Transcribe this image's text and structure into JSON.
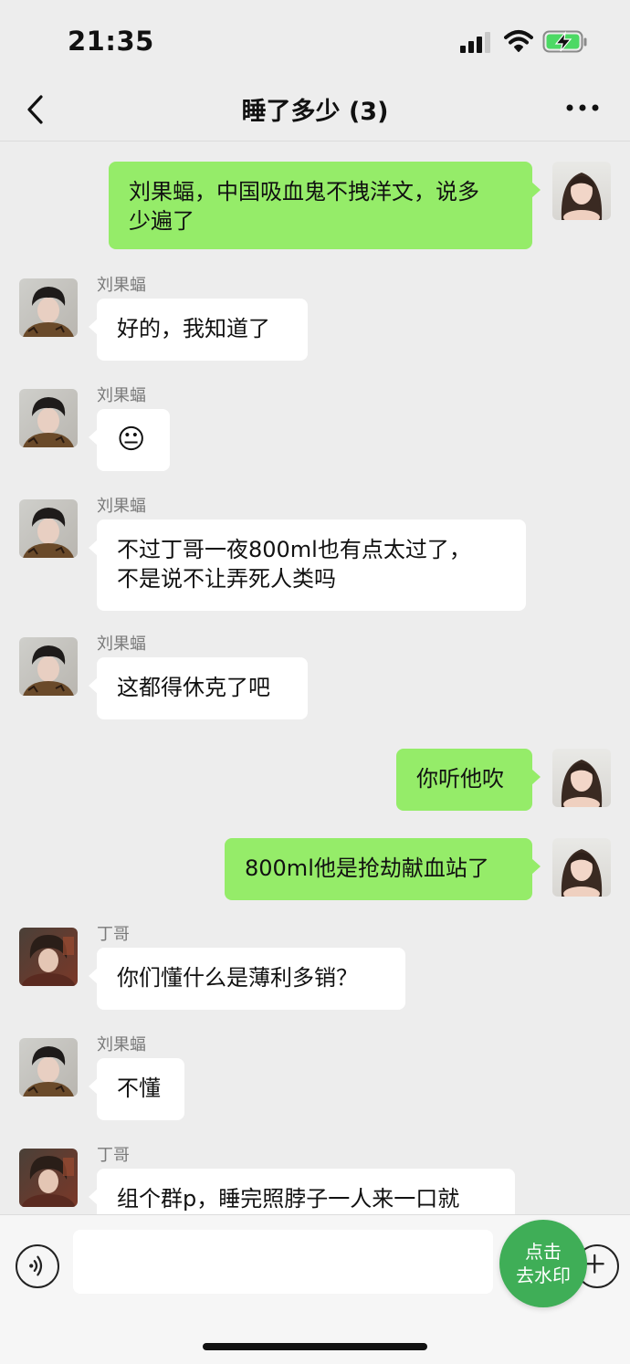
{
  "status_bar": {
    "time": "21:35"
  },
  "nav": {
    "title": "睡了多少 (3)"
  },
  "messages": [
    {
      "direction": "out",
      "text_lines": [
        "刘果蝠，中国吸血鬼不拽洋文，说多",
        "少遍了"
      ]
    },
    {
      "direction": "in",
      "sender": "刘果蝠",
      "text": "好的，我知道了"
    },
    {
      "direction": "in",
      "sender": "刘果蝠",
      "text": "😐"
    },
    {
      "direction": "in",
      "sender": "刘果蝠",
      "text_lines": [
        "不过丁哥一夜800ml也有点太过了，",
        "不是说不让弄死人类吗"
      ]
    },
    {
      "direction": "in",
      "sender": "刘果蝠",
      "text": "这都得休克了吧"
    },
    {
      "direction": "out",
      "text": "你听他吹"
    },
    {
      "direction": "out",
      "text": "800ml他是抢劫献血站了"
    },
    {
      "direction": "in",
      "sender": "丁哥",
      "text": "你们懂什么是薄利多销？"
    },
    {
      "direction": "in",
      "sender": "刘果蝠",
      "text": "不懂"
    },
    {
      "direction": "in",
      "sender": "丁哥",
      "text": "组个群p，睡完照脖子一人来一口就"
    }
  ],
  "input_bar": {
    "watermark_button_line1": "点击",
    "watermark_button_line2": "去水印"
  },
  "icons": {
    "back": "chevron-left-icon",
    "more": "more-dots-icon",
    "voice": "voice-icon",
    "plus": "plus-icon",
    "signal": "signal-icon",
    "wifi": "wifi-icon",
    "battery": "battery-charging-icon"
  },
  "colors": {
    "background": "#EDEDED",
    "outgoing_bubble": "#95EC69",
    "incoming_bubble": "#FFFFFF",
    "watermark_button": "#3FAE57",
    "battery": "#4CD964"
  }
}
